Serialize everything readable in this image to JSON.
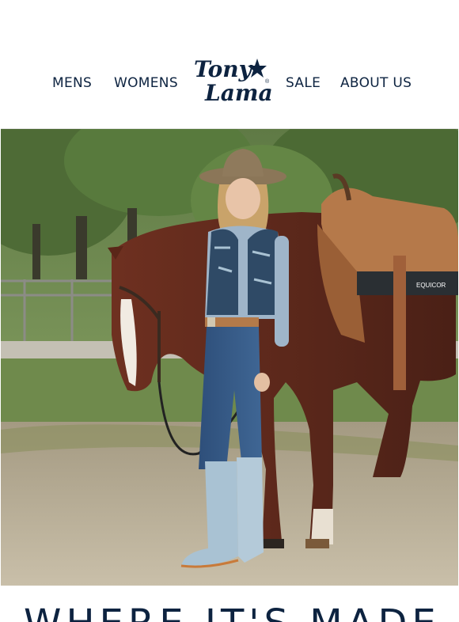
{
  "nav": {
    "mens": "MENS",
    "womens": "WOMENS",
    "sale": "SALE",
    "about": "ABOUT US"
  },
  "logo": {
    "line1": "Tony",
    "line2": "Lama",
    "mark": "®",
    "icon": "star-icon"
  },
  "hero": {
    "saddle_pad_label": "EQUICOR"
  },
  "headline": {
    "text": "WHERE IT'S MADE"
  },
  "colors": {
    "brand_navy": "#0d2340",
    "boot_blue": "#a9c2d3"
  }
}
